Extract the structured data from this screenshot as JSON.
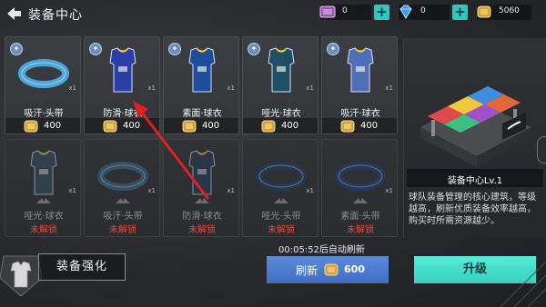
{
  "header": {
    "title": "装备中心"
  },
  "resources": {
    "ticket": "0",
    "gem": "0",
    "gold": "5060"
  },
  "items": [
    {
      "name": "吸汗·头带",
      "price": "400",
      "qty": "x1",
      "locked": false,
      "type": "headband",
      "color": "#4aa6d9"
    },
    {
      "name": "防滑·球衣",
      "price": "400",
      "qty": "x1",
      "locked": false,
      "type": "jersey",
      "color": "#2b3ea8"
    },
    {
      "name": "素面·球衣",
      "price": "400",
      "qty": "x1",
      "locked": false,
      "type": "jersey",
      "color": "#1e4d9c"
    },
    {
      "name": "哑光·球衣",
      "price": "400",
      "qty": "x1",
      "locked": false,
      "type": "jersey",
      "color": "#1f4f66"
    },
    {
      "name": "吸汗·球衣",
      "price": "400",
      "qty": "x1",
      "locked": false,
      "type": "jersey",
      "color": "#4d6fb8"
    },
    {
      "name": "哑光·球衣",
      "status": "未解锁",
      "qty": "x1",
      "locked": true,
      "type": "jersey",
      "color": "#2f4f5c"
    },
    {
      "name": "吸汗·头带",
      "status": "未解锁",
      "qty": "x1",
      "locked": true,
      "type": "headband",
      "color": "#3a6b8a"
    },
    {
      "name": "防滑·球衣",
      "status": "未解锁",
      "qty": "x1",
      "locked": true,
      "type": "jersey",
      "color": "#2a3a5a"
    },
    {
      "name": "哑光·头带",
      "status": "未解锁",
      "qty": "x1",
      "locked": true,
      "type": "headband",
      "color": "#20406a"
    },
    {
      "name": "素面·头带",
      "status": "未解锁",
      "qty": "x1",
      "locked": true,
      "type": "headband",
      "color": "#1f3f7a"
    }
  ],
  "building": {
    "name": "装备中心Lv.1",
    "description": "球队装备管理的核心建筑，等级越高，刷新优质装备效率越高，购买时所需资源越少。"
  },
  "bottom": {
    "enhance_label": "装备强化",
    "refresh_timer": "00:05:52后自动刷新",
    "refresh_label": "刷新",
    "refresh_cost": "600",
    "upgrade_label": "升级"
  },
  "colors": {
    "accent_teal": "#37d1be",
    "refresh_blue": "#4a7ccc",
    "locked_red": "#e24a3a",
    "arrow_red": "#e02020"
  }
}
